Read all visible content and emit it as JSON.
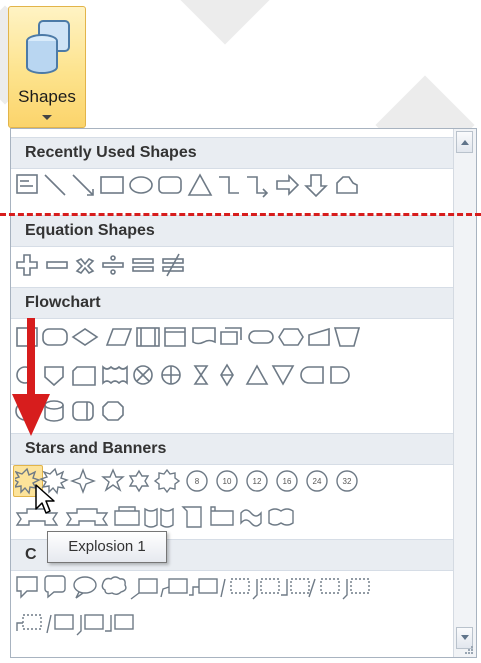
{
  "ribbon": {
    "shapes_label": "Shapes",
    "icon": "cylinder-shapes-icon"
  },
  "gallery": {
    "sections": [
      {
        "title": "Recently Used Shapes"
      },
      {
        "title": "Equation Shapes"
      },
      {
        "title": "Flowchart"
      },
      {
        "title": "Stars and Banners",
        "star_labels": [
          "8",
          "10",
          "12",
          "16",
          "24",
          "32"
        ]
      },
      {
        "title": "C"
      }
    ],
    "tooltip": "Explosion 1",
    "selected_shape": "Explosion 1"
  },
  "colors": {
    "annotation_red": "#d71d1d",
    "highlight": "#fce39a",
    "shape_stroke": "#6e7a86"
  }
}
